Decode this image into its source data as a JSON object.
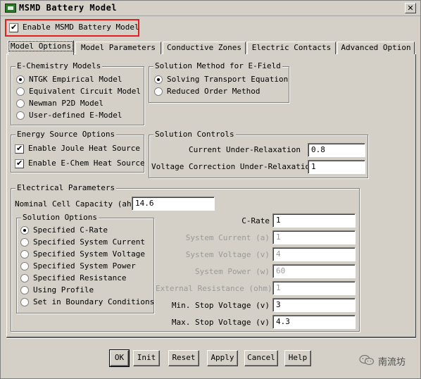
{
  "window": {
    "title": "MSMD Battery Model",
    "close_glyph": "✕"
  },
  "enable": {
    "label": "Enable MSMD Battery Model",
    "checked": true,
    "highlight_color": "#e0201e"
  },
  "tabs": [
    {
      "label": "Model Options",
      "active": true
    },
    {
      "label": "Model Parameters",
      "active": false
    },
    {
      "label": "Conductive Zones",
      "active": false
    },
    {
      "label": "Electric Contacts",
      "active": false
    },
    {
      "label": "Advanced Option",
      "active": false
    }
  ],
  "echem": {
    "title": "E-Chemistry Models",
    "options": [
      {
        "label": "NTGK Empirical Model",
        "checked": true
      },
      {
        "label": "Equivalent Circuit Model",
        "checked": false
      },
      {
        "label": "Newman P2D Model",
        "checked": false
      },
      {
        "label": "User-defined E-Model",
        "checked": false
      }
    ]
  },
  "solution_method": {
    "title": "Solution Method for E-Field",
    "options": [
      {
        "label": "Solving Transport Equation",
        "checked": true
      },
      {
        "label": "Reduced Order Method",
        "checked": false
      }
    ]
  },
  "energy": {
    "title": "Energy Source Options",
    "options": [
      {
        "label": "Enable Joule Heat Source",
        "checked": true
      },
      {
        "label": "Enable E-Chem Heat Source",
        "checked": true
      }
    ]
  },
  "controls": {
    "title": "Solution Controls",
    "current_label": "Current Under-Relaxation",
    "current_value": "0.8",
    "voltage_label": "Voltage Correction Under-Relaxation",
    "voltage_value": "1"
  },
  "electrical": {
    "title": "Electrical Parameters",
    "capacity_label": "Nominal Cell Capacity  (ah)",
    "capacity_value": "14.6",
    "solution_options": {
      "title": "Solution Options",
      "options": [
        {
          "label": "Specified C-Rate",
          "checked": true
        },
        {
          "label": "Specified System Current",
          "checked": false
        },
        {
          "label": "Specified System Voltage",
          "checked": false
        },
        {
          "label": "Specified System Power",
          "checked": false
        },
        {
          "label": "Specified Resistance",
          "checked": false
        },
        {
          "label": "Using Profile",
          "checked": false
        },
        {
          "label": "Set in Boundary Conditions",
          "checked": false
        }
      ]
    },
    "fields": [
      {
        "label": "C-Rate",
        "value": "1",
        "enabled": true
      },
      {
        "label": "System Current  (a)",
        "value": "1",
        "enabled": false
      },
      {
        "label": "System Voltage  (v)",
        "value": "4",
        "enabled": false
      },
      {
        "label": "System Power  (w)",
        "value": "60",
        "enabled": false
      },
      {
        "label": "External Resistance  (ohm)",
        "value": "1",
        "enabled": false
      },
      {
        "label": "Min. Stop Voltage  (v)",
        "value": "3",
        "enabled": true
      },
      {
        "label": "Max. Stop Voltage  (v)",
        "value": "4.3",
        "enabled": true
      }
    ]
  },
  "buttons": {
    "ok": "OK",
    "init": "Init",
    "reset": "Reset",
    "apply": "Apply",
    "cancel": "Cancel",
    "help": "Help"
  },
  "watermark": {
    "text": "南流坊",
    "icon": "wechat-icon"
  }
}
